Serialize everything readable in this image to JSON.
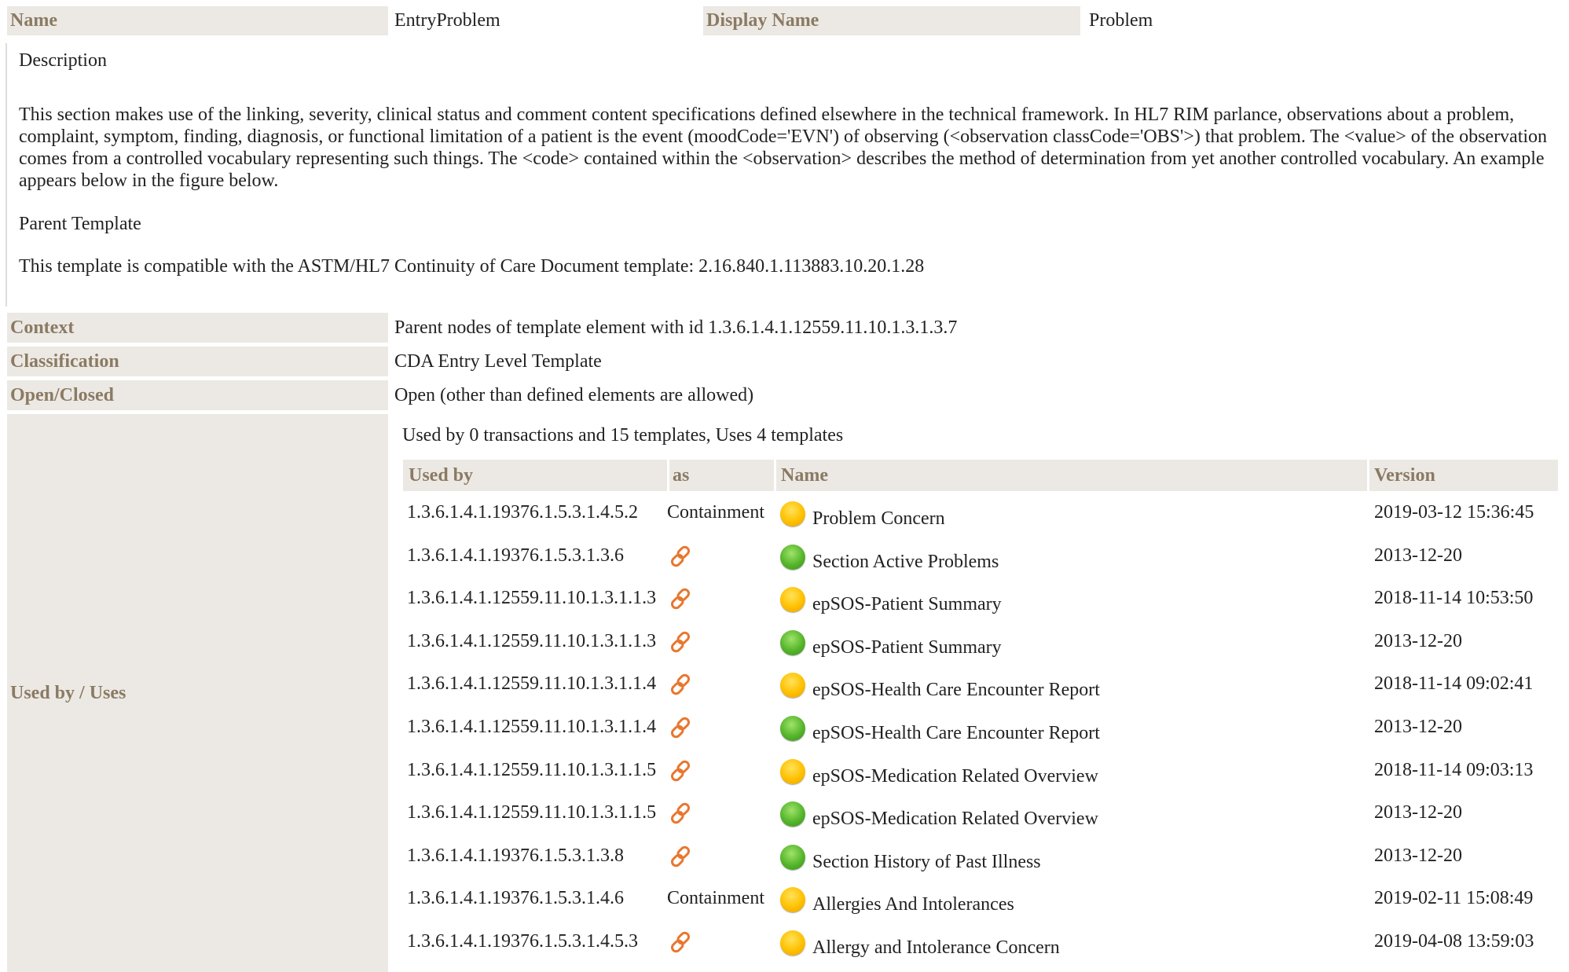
{
  "header": {
    "name_label": "Name",
    "name_value": "EntryProblem",
    "display_name_label": "Display Name",
    "display_name_value": "Problem"
  },
  "description": {
    "heading": "Description",
    "text": "This section makes use of the linking, severity, clinical status and comment content specifications defined elsewhere in the technical framework. In HL7 RIM parlance, observations about a problem, complaint, symptom, finding, diagnosis, or functional limitation of a patient is the event (moodCode='EVN') of observing (<observation classCode='OBS'>) that problem. The <value> of the observation comes from a controlled vocabulary representing such things. The <code> contained within the <observation> describes the method of determination from yet another controlled vocabulary. An example appears below in the figure below.",
    "parent_heading": "Parent Template",
    "parent_text": "This template is compatible with the ASTM/HL7 Continuity of Care Document template: 2.16.840.1.113883.10.20.1.28"
  },
  "properties": [
    {
      "label": "Context",
      "value": "Parent nodes of template element with id 1.3.6.1.4.1.12559.11.10.1.3.1.3.7"
    },
    {
      "label": "Classification",
      "value": "CDA Entry Level Template"
    },
    {
      "label": "Open/Closed",
      "value": "Open (other than defined elements are allowed)"
    }
  ],
  "used_by": {
    "label": "Used by / Uses",
    "summary": "Used by 0 transactions and 15 templates, Uses 4 templates",
    "columns": [
      "Used by",
      "as",
      "Name",
      "Version"
    ],
    "rows": [
      {
        "id": "1.3.6.1.4.1.19376.1.5.3.1.4.5.2",
        "as": "Containment",
        "as_icon": "",
        "status": "yellow",
        "name": "Problem Concern",
        "version": "2019-03-12 15:36:45"
      },
      {
        "id": "1.3.6.1.4.1.19376.1.5.3.1.3.6",
        "as": "",
        "as_icon": "link-icon",
        "status": "green",
        "name": "Section Active Problems",
        "version": "2013-12-20"
      },
      {
        "id": "1.3.6.1.4.1.12559.11.10.1.3.1.1.3",
        "as": "",
        "as_icon": "link-icon",
        "status": "yellow",
        "name": "epSOS-Patient Summary",
        "version": "2018-11-14 10:53:50"
      },
      {
        "id": "1.3.6.1.4.1.12559.11.10.1.3.1.1.3",
        "as": "",
        "as_icon": "link-icon",
        "status": "green",
        "name": "epSOS-Patient Summary",
        "version": "2013-12-20"
      },
      {
        "id": "1.3.6.1.4.1.12559.11.10.1.3.1.1.4",
        "as": "",
        "as_icon": "link-icon",
        "status": "yellow",
        "name": "epSOS-Health Care Encounter Report",
        "version": "2018-11-14 09:02:41"
      },
      {
        "id": "1.3.6.1.4.1.12559.11.10.1.3.1.1.4",
        "as": "",
        "as_icon": "link-icon",
        "status": "green",
        "name": "epSOS-Health Care Encounter Report",
        "version": "2013-12-20"
      },
      {
        "id": "1.3.6.1.4.1.12559.11.10.1.3.1.1.5",
        "as": "",
        "as_icon": "link-icon",
        "status": "yellow",
        "name": "epSOS-Medication Related Overview",
        "version": "2018-11-14 09:03:13"
      },
      {
        "id": "1.3.6.1.4.1.12559.11.10.1.3.1.1.5",
        "as": "",
        "as_icon": "link-icon",
        "status": "green",
        "name": "epSOS-Medication Related Overview",
        "version": "2013-12-20"
      },
      {
        "id": "1.3.6.1.4.1.19376.1.5.3.1.3.8",
        "as": "",
        "as_icon": "link-icon",
        "status": "green",
        "name": "Section History of Past Illness",
        "version": "2013-12-20"
      },
      {
        "id": "1.3.6.1.4.1.19376.1.5.3.1.4.6",
        "as": "Containment",
        "as_icon": "",
        "status": "yellow",
        "name": "Allergies And Intolerances",
        "version": "2019-02-11 15:08:49"
      },
      {
        "id": "1.3.6.1.4.1.19376.1.5.3.1.4.5.3",
        "as": "",
        "as_icon": "link-icon",
        "status": "yellow",
        "name": "Allergy and Intolerance Concern",
        "version": "2019-04-08 13:59:03"
      }
    ]
  }
}
